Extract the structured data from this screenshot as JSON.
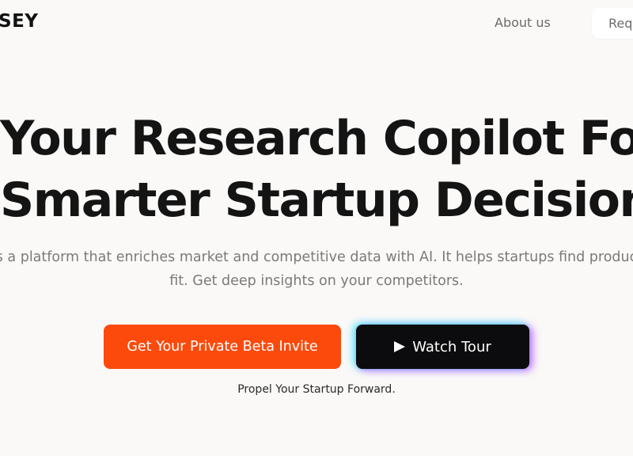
{
  "header": {
    "logo_text": "SEY",
    "nav_link_about": "About us",
    "nav_cta_label": "Requ"
  },
  "hero": {
    "headline_line1": "Your Research Copilot For",
    "headline_line2": "Smarter Startup Decisions",
    "subtext_line1": "s a platform that enriches market and competitive data with AI. It helps startups find produc",
    "subtext_line2": "fit. Get deep insights on your competitors.",
    "primary_button_label": "Get Your Private Beta Invite",
    "secondary_button_label": "Watch Tour",
    "secondary_button_icon": "play-icon",
    "tagline": "Propel Your Startup Forward."
  },
  "colors": {
    "background": "#faf9f7",
    "primary_accent": "#fc4a0d",
    "dark_button": "#0c0c0e",
    "glow_cyan": "#46e6ff",
    "glow_purple": "#be50ff"
  }
}
